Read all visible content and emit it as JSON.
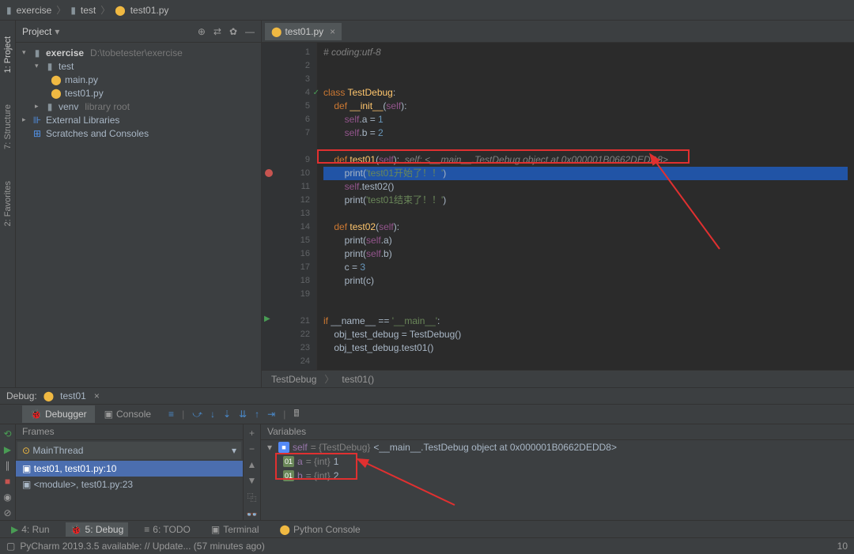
{
  "breadcrumb": {
    "root": "exercise",
    "mid": "test",
    "file": "test01.py"
  },
  "project": {
    "label": "Project",
    "root": {
      "name": "exercise",
      "path": "D:\\tobetester\\exercise"
    },
    "test_folder": "test",
    "files": {
      "main": "main.py",
      "test01": "test01.py"
    },
    "venv": "venv",
    "venv_hint": "library root",
    "ext_libs": "External Libraries",
    "scratches": "Scratches and Consoles"
  },
  "editor": {
    "tab": "test01.py",
    "lines": {
      "1": "# coding:utf-8",
      "2": "",
      "3": "",
      "4": "class TestDebug:",
      "5": "    def __init__(self):",
      "6": "        self.a = 1",
      "7": "        self.b = 2",
      "8": "",
      "9_pre": "    def test01(self):  ",
      "9_hint": "self: <__main__.TestDebug object at 0x000001B0662DEDD8>",
      "10": "        print('test01开始了！！')",
      "11": "        self.test02()",
      "12": "        print('test01结束了！！')",
      "13": "",
      "14": "    def test02(self):",
      "15": "        print(self.a)",
      "16": "        print(self.b)",
      "17": "        c = 3",
      "18": "        print(c)",
      "19": "",
      "20": "",
      "21": "if __name__ == '__main__':",
      "22": "    obj_test_debug = TestDebug()",
      "23": "    obj_test_debug.test01()",
      "24": ""
    },
    "crumb": {
      "cls": "TestDebug",
      "fn": "test01()"
    }
  },
  "debug": {
    "title": "Debug:",
    "config": "test01",
    "tabs": {
      "debugger": "Debugger",
      "console": "Console"
    },
    "frames": {
      "hdr": "Frames",
      "thread": "MainThread",
      "f0": "test01, test01.py:10",
      "f1": "<module>, test01.py:23"
    },
    "vars": {
      "hdr": "Variables",
      "self": {
        "name": "self",
        "type": "= {TestDebug}",
        "val": "<__main__.TestDebug object at 0x000001B0662DEDD8>"
      },
      "a": {
        "name": "a",
        "type": "= {int}",
        "val": "1"
      },
      "b": {
        "name": "b",
        "type": "= {int}",
        "val": "2"
      }
    }
  },
  "bottom": {
    "run": "4: Run",
    "debug": "5: Debug",
    "todo": "6: TODO",
    "terminal": "Terminal",
    "pyconsole": "Python Console"
  },
  "status": {
    "msg": "PyCharm 2019.3.5 available: // Update... (57 minutes ago)",
    "pos": "10"
  },
  "side": {
    "project": "1: Project",
    "structure": "7: Structure",
    "favorites": "2: Favorites"
  }
}
